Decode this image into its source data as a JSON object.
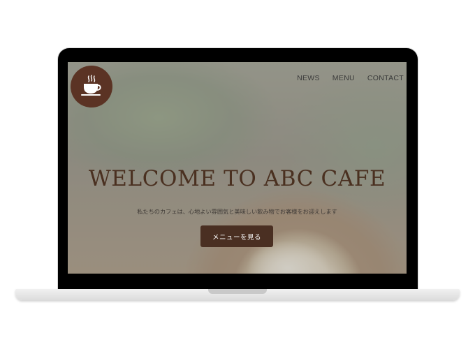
{
  "header": {
    "logo_icon": "coffee-cup-icon",
    "nav": [
      {
        "label": "NEWS"
      },
      {
        "label": "MENU"
      },
      {
        "label": "CONTACT"
      }
    ]
  },
  "hero": {
    "title": "WELCOME TO ABC CAFE",
    "subtitle": "私たちのカフェは、心地よい雰囲気と美味しい飲み物でお客様をお迎えします",
    "button_label": "メニューを見る"
  },
  "colors": {
    "brand_brown": "#5b3324",
    "button_brown": "#4a2f22",
    "title_brown": "#4a3020"
  }
}
